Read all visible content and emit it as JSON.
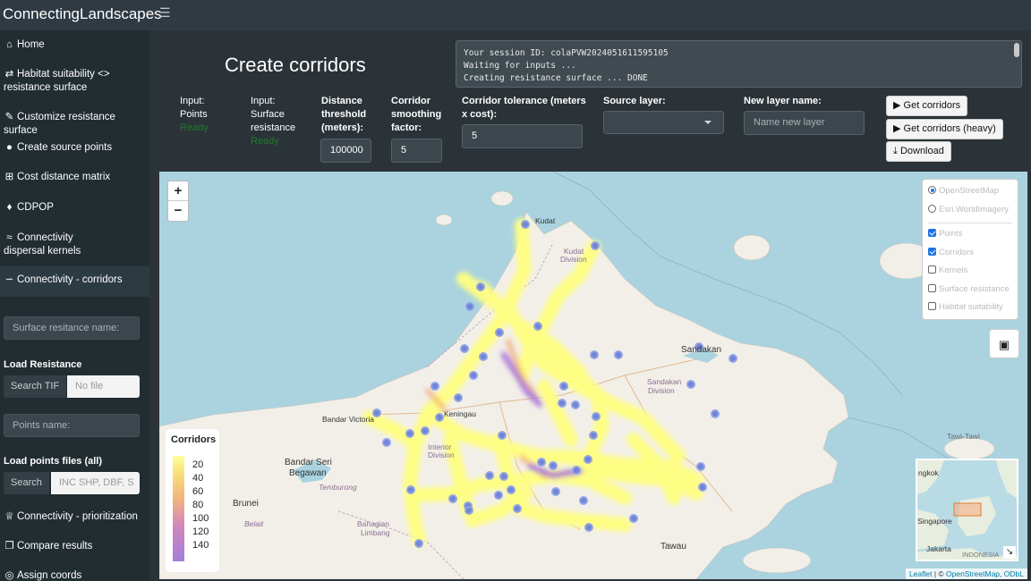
{
  "app": {
    "title": "ConnectingLandscapes"
  },
  "sidebar": {
    "items": [
      {
        "icon": "home-icon",
        "label": "Home"
      },
      {
        "icon": "exchange-icon",
        "label": "Habitat suitability <> resistance surface"
      },
      {
        "icon": "pencil-icon",
        "label": "Customize resistance surface"
      },
      {
        "icon": "map-pin-icon",
        "label": "Create source points"
      },
      {
        "icon": "table-icon",
        "label": "Cost distance matrix"
      },
      {
        "icon": "frog-icon",
        "label": "CDPOP"
      },
      {
        "icon": "route-icon",
        "label": "Connectivity dispersal kernels"
      },
      {
        "icon": "network-icon",
        "label": "Connectivity - corridors"
      },
      {
        "icon": "trophy-icon",
        "label": "Connectivity - prioritization"
      },
      {
        "icon": "copy-icon",
        "label": "Compare results"
      },
      {
        "icon": "globe-icon",
        "label": "Assign coords"
      }
    ],
    "surface_name_placeholder": "Surface resitance name:",
    "load_resistance_label": "Load Resistance",
    "resistance_browse": "Search TIF",
    "resistance_file": "No file",
    "points_name_placeholder": "Points name:",
    "load_points_label": "Load points files (all)",
    "points_browse": "Search",
    "points_file": "INC SHP, DBF, S"
  },
  "main": {
    "title": "Create corridors",
    "console_lines": [
      "Your session ID: colaPVW2024051611595105",
      "Waiting for inputs ...",
      "Creating resistance surface ... DONE"
    ],
    "input_points": {
      "label1": "Input:",
      "label2": "Points",
      "status": "Ready"
    },
    "input_surface": {
      "label1": "Input:",
      "label2": "Surface",
      "label3": "resistance",
      "status": "Ready"
    },
    "distance": {
      "label1": "Distance",
      "label2": "threshold",
      "label3": "(meters):",
      "value": "100000"
    },
    "smoothing": {
      "label1": "Corridor",
      "label2": "smoothing",
      "label3": "factor:",
      "value": "5"
    },
    "tolerance": {
      "label1": "Corridor tolerance (meters",
      "label2": "x cost):",
      "value": "5"
    },
    "source_layer": {
      "label": "Source layer:",
      "value": ""
    },
    "new_layer": {
      "label": "New layer name:",
      "placeholder": "Name new layer"
    },
    "buttons": {
      "get_corridors": "Get corridors",
      "get_corridors_heavy": "Get corridors (heavy)",
      "download": "Download"
    }
  },
  "map": {
    "layers": {
      "base": [
        {
          "label": "OpenStreetMap",
          "selected": true
        },
        {
          "label": "Esri.WorldImagery",
          "selected": false
        }
      ],
      "overlays": [
        {
          "label": "Points",
          "checked": true
        },
        {
          "label": "Corridors",
          "checked": true
        },
        {
          "label": "Kernels",
          "checked": false
        },
        {
          "label": "Surface resistance",
          "checked": false
        },
        {
          "label": "Habitat suitability",
          "checked": false
        }
      ]
    },
    "legend": {
      "title": "Corridors",
      "ticks": [
        "20",
        "40",
        "60",
        "80",
        "100",
        "120",
        "140"
      ]
    },
    "place_labels": {
      "kudat": "Kudat",
      "kudat_div": "Kudat",
      "kudat_div2": "Division",
      "sandakan": "Sandakan",
      "sandakan_div": "Sandakan",
      "sandakan_div2": "Division",
      "bandar_victoria": "Bandar Victoria",
      "keningau": "Keningau",
      "bandar_seri": "Bandar Seri",
      "begawan": "Begawan",
      "temburong": "Temburong",
      "brunei": "Brunei",
      "belait": "Belait",
      "bahagian": "Bahagian",
      "limbang": "Limbang",
      "tawau": "Tawau",
      "tawi_tawi": "Tawi-Tawi",
      "interior": "Interior",
      "division": "Division"
    },
    "minimap_labels": {
      "bangkok": "ngkok",
      "singapore": "Singapore",
      "jakarta": "Jakarta",
      "indonesia": "INDONESIA"
    },
    "attribution": {
      "leaflet": "Leaflet",
      "sep": " | © ",
      "osm": "OpenStreetMap",
      "odbl": "ODbL"
    },
    "colors": {
      "water": "#aad3df",
      "land": "#f2efe9",
      "corridor_low": "#ffff8a",
      "corridor_high": "#8a5cd6",
      "point": "#6b7fd7"
    }
  }
}
